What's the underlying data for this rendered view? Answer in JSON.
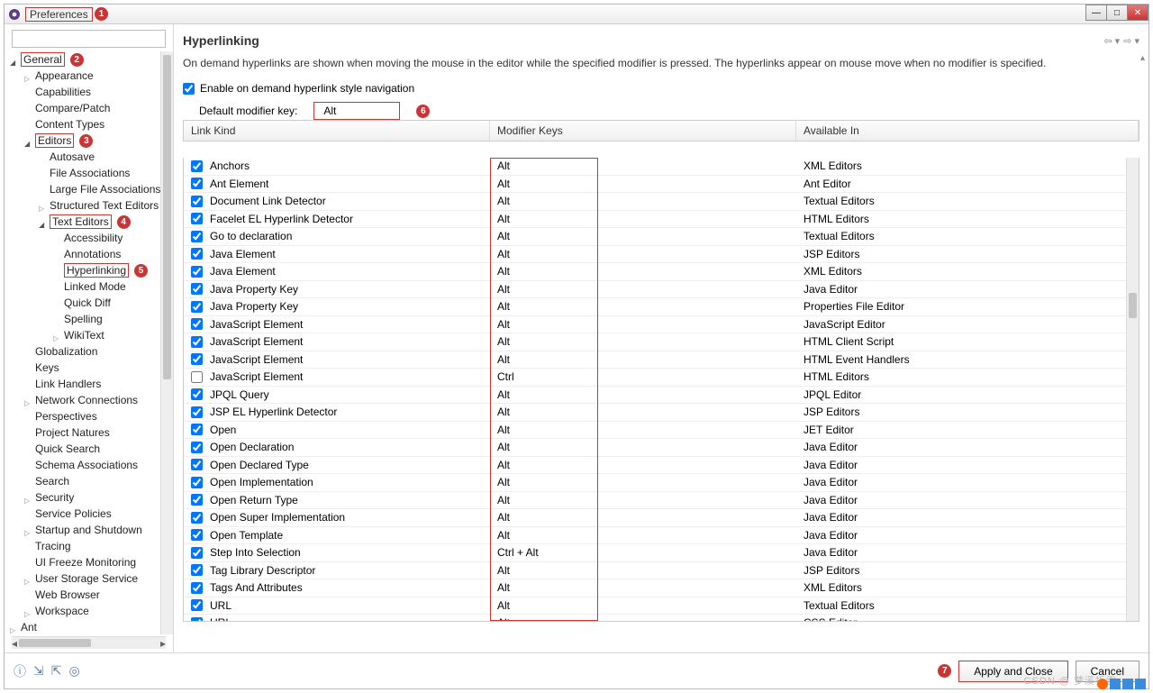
{
  "window": {
    "title": "Preferences"
  },
  "winctrls": {
    "min": "—",
    "max": "□",
    "close": "✕"
  },
  "sidebar": {
    "filter_placeholder": "",
    "items": [
      {
        "label": "General",
        "depth": 0,
        "tw": "open",
        "boxed": true,
        "anno": 2
      },
      {
        "label": "Appearance",
        "depth": 1,
        "tw": "closed"
      },
      {
        "label": "Capabilities",
        "depth": 1
      },
      {
        "label": "Compare/Patch",
        "depth": 1
      },
      {
        "label": "Content Types",
        "depth": 1
      },
      {
        "label": "Editors",
        "depth": 1,
        "tw": "open",
        "boxed": true,
        "anno": 3
      },
      {
        "label": "Autosave",
        "depth": 2
      },
      {
        "label": "File Associations",
        "depth": 2
      },
      {
        "label": "Large File Associations",
        "depth": 2
      },
      {
        "label": "Structured Text Editors",
        "depth": 2,
        "tw": "closed"
      },
      {
        "label": "Text Editors",
        "depth": 2,
        "tw": "open",
        "boxed": true,
        "anno": 4
      },
      {
        "label": "Accessibility",
        "depth": 3
      },
      {
        "label": "Annotations",
        "depth": 3
      },
      {
        "label": "Hyperlinking",
        "depth": 3,
        "boxed": true,
        "anno": 5
      },
      {
        "label": "Linked Mode",
        "depth": 3
      },
      {
        "label": "Quick Diff",
        "depth": 3
      },
      {
        "label": "Spelling",
        "depth": 3
      },
      {
        "label": "WikiText",
        "depth": 3,
        "tw": "closed"
      },
      {
        "label": "Globalization",
        "depth": 1
      },
      {
        "label": "Keys",
        "depth": 1
      },
      {
        "label": "Link Handlers",
        "depth": 1
      },
      {
        "label": "Network Connections",
        "depth": 1,
        "tw": "closed"
      },
      {
        "label": "Perspectives",
        "depth": 1
      },
      {
        "label": "Project Natures",
        "depth": 1
      },
      {
        "label": "Quick Search",
        "depth": 1
      },
      {
        "label": "Schema Associations",
        "depth": 1
      },
      {
        "label": "Search",
        "depth": 1
      },
      {
        "label": "Security",
        "depth": 1,
        "tw": "closed"
      },
      {
        "label": "Service Policies",
        "depth": 1
      },
      {
        "label": "Startup and Shutdown",
        "depth": 1,
        "tw": "closed"
      },
      {
        "label": "Tracing",
        "depth": 1
      },
      {
        "label": "UI Freeze Monitoring",
        "depth": 1
      },
      {
        "label": "User Storage Service",
        "depth": 1,
        "tw": "closed"
      },
      {
        "label": "Web Browser",
        "depth": 1
      },
      {
        "label": "Workspace",
        "depth": 1,
        "tw": "closed"
      },
      {
        "label": "Ant",
        "depth": 0,
        "tw": "closed"
      }
    ]
  },
  "page": {
    "title": "Hyperlinking",
    "description": "On demand hyperlinks are shown when moving the mouse in the editor while the specified modifier is pressed. The hyperlinks appear on mouse move when no modifier is specified.",
    "enable_label": "Enable on demand hyperlink style navigation",
    "enable_checked": true,
    "modifier_label": "Default modifier key:",
    "modifier_value": "Alt",
    "columns": {
      "c1": "Link Kind",
      "c2": "Modifier Keys",
      "c3": "Available In"
    },
    "rows": [
      {
        "on": true,
        "kind": "Anchors",
        "mod": "Alt",
        "avail": "XML Editors"
      },
      {
        "on": true,
        "kind": "Ant Element",
        "mod": "Alt",
        "avail": "Ant Editor"
      },
      {
        "on": true,
        "kind": "Document Link Detector",
        "mod": "Alt",
        "avail": "Textual Editors"
      },
      {
        "on": true,
        "kind": "Facelet EL Hyperlink Detector",
        "mod": "Alt",
        "avail": "HTML Editors"
      },
      {
        "on": true,
        "kind": "Go to declaration",
        "mod": "Alt",
        "avail": "Textual Editors"
      },
      {
        "on": true,
        "kind": "Java Element",
        "mod": "Alt",
        "avail": "JSP Editors"
      },
      {
        "on": true,
        "kind": "Java Element",
        "mod": "Alt",
        "avail": "XML Editors"
      },
      {
        "on": true,
        "kind": "Java Property Key",
        "mod": "Alt",
        "avail": "Java Editor"
      },
      {
        "on": true,
        "kind": "Java Property Key",
        "mod": "Alt",
        "avail": "Properties File Editor"
      },
      {
        "on": true,
        "kind": "JavaScript Element",
        "mod": "Alt",
        "avail": "JavaScript Editor"
      },
      {
        "on": true,
        "kind": "JavaScript Element",
        "mod": "Alt",
        "avail": "HTML Client Script"
      },
      {
        "on": true,
        "kind": "JavaScript Element",
        "mod": "Alt",
        "avail": "HTML Event Handlers"
      },
      {
        "on": false,
        "kind": "JavaScript Element",
        "mod": "Ctrl",
        "avail": "HTML Editors"
      },
      {
        "on": true,
        "kind": "JPQL Query",
        "mod": "Alt",
        "avail": "JPQL Editor"
      },
      {
        "on": true,
        "kind": "JSP EL Hyperlink Detector",
        "mod": "Alt",
        "avail": "JSP Editors"
      },
      {
        "on": true,
        "kind": "Open",
        "mod": "Alt",
        "avail": "JET Editor"
      },
      {
        "on": true,
        "kind": "Open Declaration",
        "mod": "Alt",
        "avail": "Java Editor"
      },
      {
        "on": true,
        "kind": "Open Declared Type",
        "mod": "Alt",
        "avail": "Java Editor"
      },
      {
        "on": true,
        "kind": "Open Implementation",
        "mod": "Alt",
        "avail": "Java Editor"
      },
      {
        "on": true,
        "kind": "Open Return Type",
        "mod": "Alt",
        "avail": "Java Editor"
      },
      {
        "on": true,
        "kind": "Open Super Implementation",
        "mod": "Alt",
        "avail": "Java Editor"
      },
      {
        "on": true,
        "kind": "Open Template",
        "mod": "Alt",
        "avail": "Java Editor"
      },
      {
        "on": true,
        "kind": "Step Into Selection",
        "mod": "Ctrl + Alt",
        "avail": "Java Editor"
      },
      {
        "on": true,
        "kind": "Tag Library Descriptor",
        "mod": "Alt",
        "avail": "JSP Editors"
      },
      {
        "on": true,
        "kind": "Tags And Attributes",
        "mod": "Alt",
        "avail": "XML Editors"
      },
      {
        "on": true,
        "kind": "URL",
        "mod": "Alt",
        "avail": "Textual Editors"
      },
      {
        "on": true,
        "kind": "URL",
        "mod": "Alt",
        "avail": "CSS Editor"
      }
    ]
  },
  "footer": {
    "apply": "Apply and Close",
    "cancel": "Cancel"
  },
  "annotations": {
    "a1": "1",
    "a2": "2",
    "a3": "3",
    "a4": "4",
    "a5": "5",
    "a6": "6",
    "a7": "7"
  },
  "watermark": "CSDN @ 梦溪折雪"
}
